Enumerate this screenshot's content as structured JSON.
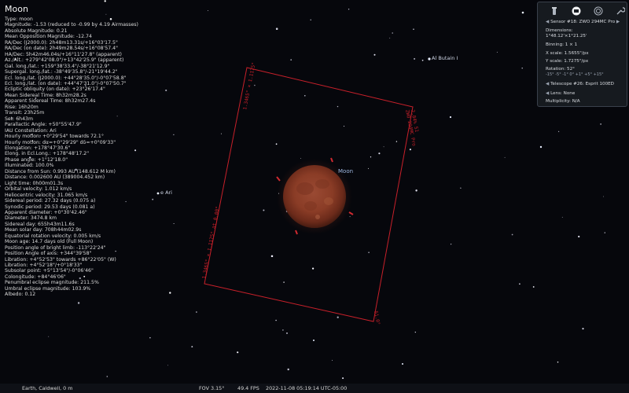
{
  "object": {
    "title": "Moon",
    "info_lines": [
      "Type: moon",
      "Magnitude: -1.53 (reduced to -0.99 by 4.19 Airmasses)",
      "Absolute Magnitude: 0.21",
      "Mean Opposition Magnitude: -12.74",
      "RA/Dec (J2000.0): 2h48m13.31s/+16°03'17.5\"",
      "RA/Dec (on date): 2h49m28.54s/+16°08'57.4\"",
      "HA/Dec: 5h42m46.04s/+16°11'27.8\" (apparent)",
      "Az./Alt.: +279°42'08.0\"/+13°42'25.9\" (apparent)",
      "Gal. long./lat.: +159°38'33.4\"/-38°21'12.9\"",
      "Supergal. long./lat.: -38°49'35.8\"/-21°19'44.2\"",
      "Ecl. long./lat. (J2000.0): +44°28'35.0\"/-0°07'58.8\"",
      "Ecl. long./lat. (on date): +44°47'31.0\"/-0°07'50.7\"",
      "Ecliptic obliquity (on date): +23°26'17.4\"",
      "Mean Sidereal Time: 8h32m28.2s",
      "Apparent Sidereal Time: 8h32m27.4s",
      "Rise: 16h20m",
      "Transit: 23h25m",
      "Set: 6h43m",
      "Parallactic Angle: +50°55'47.9\"",
      "IAU Constellation: Ari",
      "Hourly motion: +0°29'54\" towards 72.1°",
      "Hourly motion: dα=+0°29'29\" dδ=+0°09'33\"",
      "Elongation: +178°47'30.6\"",
      "Elong. in Ecl.Long.: +178°48'17.2\"",
      "Phase angle: +1°12'18.0\"",
      "Illuminated: 100.0%",
      "Distance from Sun: 0.993 AU (148.612 M km)",
      "Distance: 0.002600 AU (389004.452 km)",
      "Light time: 0h00m01.3s",
      "Orbital velocity: 1.012 km/s",
      "Heliocentric velocity: 31.065 km/s",
      "Sidereal period: 27.32 days (0.075 a)",
      "Synodic period: 29.53 days (0.081 a)",
      "Apparent diameter: +0°30'42.46\"",
      "Diameter: 3474.8 km",
      "Sidereal day: 655h43m11.6s",
      "Mean solar day: 708h44m02.9s",
      "Equatorial rotation velocity: 0.005 km/s",
      "Moon age: 14.7 days old (Full Moon)",
      "Position angle of bright limb: -113°22'24\"",
      "Position Angle of axis: +344°39'58\"",
      "Libration: +4°52'53\" towards +86°22'05\" (W)",
      "Libration: +4°52'18\"/+0°18'33\"",
      "Subsolar point: +5°13'54\"/-0°06'46\"",
      "Colongitude: +84°46'06\"",
      "Penumbral eclipse magnitude: 211.5%",
      "Umbral eclipse magnitude: 103.9%",
      "Albedo: 0.12"
    ]
  },
  "sky_labels": {
    "moon": "Moon",
    "al_butain": "Al Butain I",
    "e_ari": "e Ari"
  },
  "frame_labels": {
    "left": "1.3465° × 1.1175° at 0.00°",
    "right": "ZWO 294MC Pro\n2.84% S1",
    "top_left_corner": "",
    "bottom_right_corner": "51.0°"
  },
  "oculars": {
    "sensor": "Sensor #18: ZWO 294MC  Pro",
    "dimensions_label": "Dimensions:",
    "dimensions_value": "1°48.12'×1°21.25'",
    "binning": "Binning: 1 × 1",
    "x_scale": "X scale: 1.5655\"/px",
    "y_scale": "Y scale: 1.7275\"/px",
    "rotation": "Rotation: 52°",
    "rotation_steps": "-15°  -5°  -1°  0°  +1°  +5°  +15°",
    "telescope": "Telescope #26: Esprit 100ED",
    "lens": "Lens: None",
    "multiplicity": "Multiplicity: N/A",
    "arrow_left": "◀",
    "arrow_right": "▶"
  },
  "status_bar": {
    "location": "Earth, Caldwell, 0 m",
    "fov": "FOV 3.15°",
    "fps": "49.4 FPS",
    "datetime": "2022-11-08 05:19:14 UTC-05:00"
  },
  "colors": {
    "frame": "#c8202a",
    "moon_core": "#a0472e",
    "moon_edge": "#5e2518",
    "label": "#9fb8e0"
  }
}
